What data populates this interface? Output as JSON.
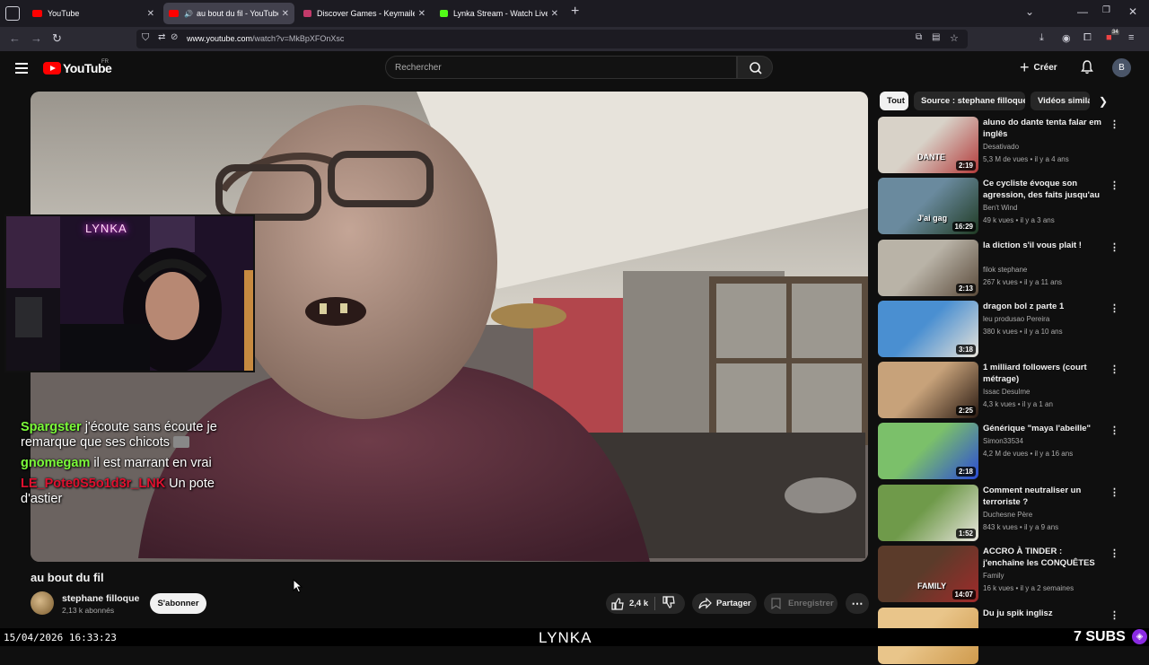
{
  "browser": {
    "tabs": [
      {
        "label": "YouTube",
        "favicon_color": "#ff0000"
      },
      {
        "label": "au bout du fil - YouTube",
        "favicon_color": "#ff0000"
      },
      {
        "label": "Discover Games - Keymailer",
        "favicon_color": "#c23a6a"
      },
      {
        "label": "Lynka Stream - Watch Live on K",
        "favicon_color": "#53fc18"
      }
    ],
    "url_prefix": "www.youtube.com",
    "url_path": "/watch?v=MkBpXFOnXsc",
    "extension_badge": "34"
  },
  "masthead": {
    "logo": "YouTube",
    "country": "FR",
    "search_placeholder": "Rechercher",
    "create_label": "Créer",
    "avatar_letter": "B"
  },
  "chat": [
    {
      "user": "Spargster",
      "text": "j'écoute sans écoute je remarque que ses chicots",
      "color": "#7cfc3a"
    },
    {
      "user": "gnomegam",
      "text": "il est marrant en vrai",
      "color": "#7cfc3a"
    },
    {
      "user": "LE_Pote0S5o1d3r_LNK",
      "text": "Un pote d'astier",
      "color": "#e0102f"
    }
  ],
  "cam": {
    "neon_sign": "LYNKA"
  },
  "video": {
    "title": "au bout du fil",
    "channel": "stephane filloque",
    "subscribers": "2,13 k abonnés",
    "subscribe_label": "S'abonner",
    "likes": "2,4 k",
    "share_label": "Partager",
    "save_label": "Enregistrer"
  },
  "chips": [
    {
      "label": "Tout"
    },
    {
      "label": "Source : stephane filloque"
    },
    {
      "label": "Vidéos simila"
    }
  ],
  "recommendations": [
    {
      "title": "aluno do dante tenta falar em inglês",
      "channel": "Desativado",
      "meta": "5,3 M de vues • il y a 4 ans",
      "duration": "2:19",
      "thumb": [
        "#d8d2c8",
        "#b33a3a"
      ],
      "thumb_text": "DANTE"
    },
    {
      "title": "Ce cycliste évoque son agression, des faits jusqu'au ...",
      "channel": "Ben't Wind",
      "meta": "49 k vues • il y a 3 ans",
      "duration": "16:29",
      "thumb": [
        "#6a8a9e",
        "#1f3a22"
      ],
      "thumb_text": "J'ai gag"
    },
    {
      "title": "la diction s'il vous plait !",
      "channel": "filok stephane",
      "meta": "267 k vues • il y a 11 ans",
      "duration": "2:13",
      "thumb": [
        "#b9b3a7",
        "#5a4a3a"
      ],
      "thumb_text": ""
    },
    {
      "title": "dragon bol z parte 1",
      "channel": "leu produsao Pereira",
      "meta": "380 k vues • il y a 10 ans",
      "duration": "3:18",
      "thumb": [
        "#4a8fd1",
        "#e8e3d9"
      ],
      "thumb_text": ""
    },
    {
      "title": "1 milliard followers (court métrage)",
      "channel": "Issac Desulme",
      "meta": "4,3 k vues • il y a 1 an",
      "duration": "2:25",
      "thumb": [
        "#c7a27a",
        "#2a1a12"
      ],
      "thumb_text": ""
    },
    {
      "title": "Générique \"maya l'abeille\"",
      "channel": "Simon33534",
      "meta": "4,2 M de vues • il y a 16 ans",
      "duration": "2:18",
      "thumb": [
        "#7bc06a",
        "#2b4bd6"
      ],
      "thumb_text": ""
    },
    {
      "title": "Comment neutraliser un terroriste ?",
      "channel": "Duchesne Père",
      "meta": "843 k vues • il y a 9 ans",
      "duration": "1:52",
      "thumb": [
        "#6f9a4a",
        "#eae6df"
      ],
      "thumb_text": ""
    },
    {
      "title": "ACCRO À TINDER : j'enchaîne les CONQUÊTES",
      "channel": "Family",
      "meta": "16 k vues • il y a 2 semaines",
      "duration": "14:07",
      "thumb": [
        "#5b3b2a",
        "#a02a2a"
      ],
      "thumb_text": "FAMILY"
    },
    {
      "title": "Du ju spik inglisz",
      "channel": "",
      "meta": "",
      "duration": "",
      "thumb": [
        "#e9c58a",
        "#cf9a4c"
      ],
      "thumb_text": ""
    }
  ],
  "overlay": {
    "timestamp": "15/04/2026 16:33:23",
    "brand": "LYNKA",
    "subs_count": "7",
    "subs_label": "SUBS"
  },
  "colors": {
    "youtube_red": "#ff0000",
    "chat_green": "#7cfc3a",
    "chat_red": "#e0102f",
    "badge_purple": "#8a2be2"
  }
}
